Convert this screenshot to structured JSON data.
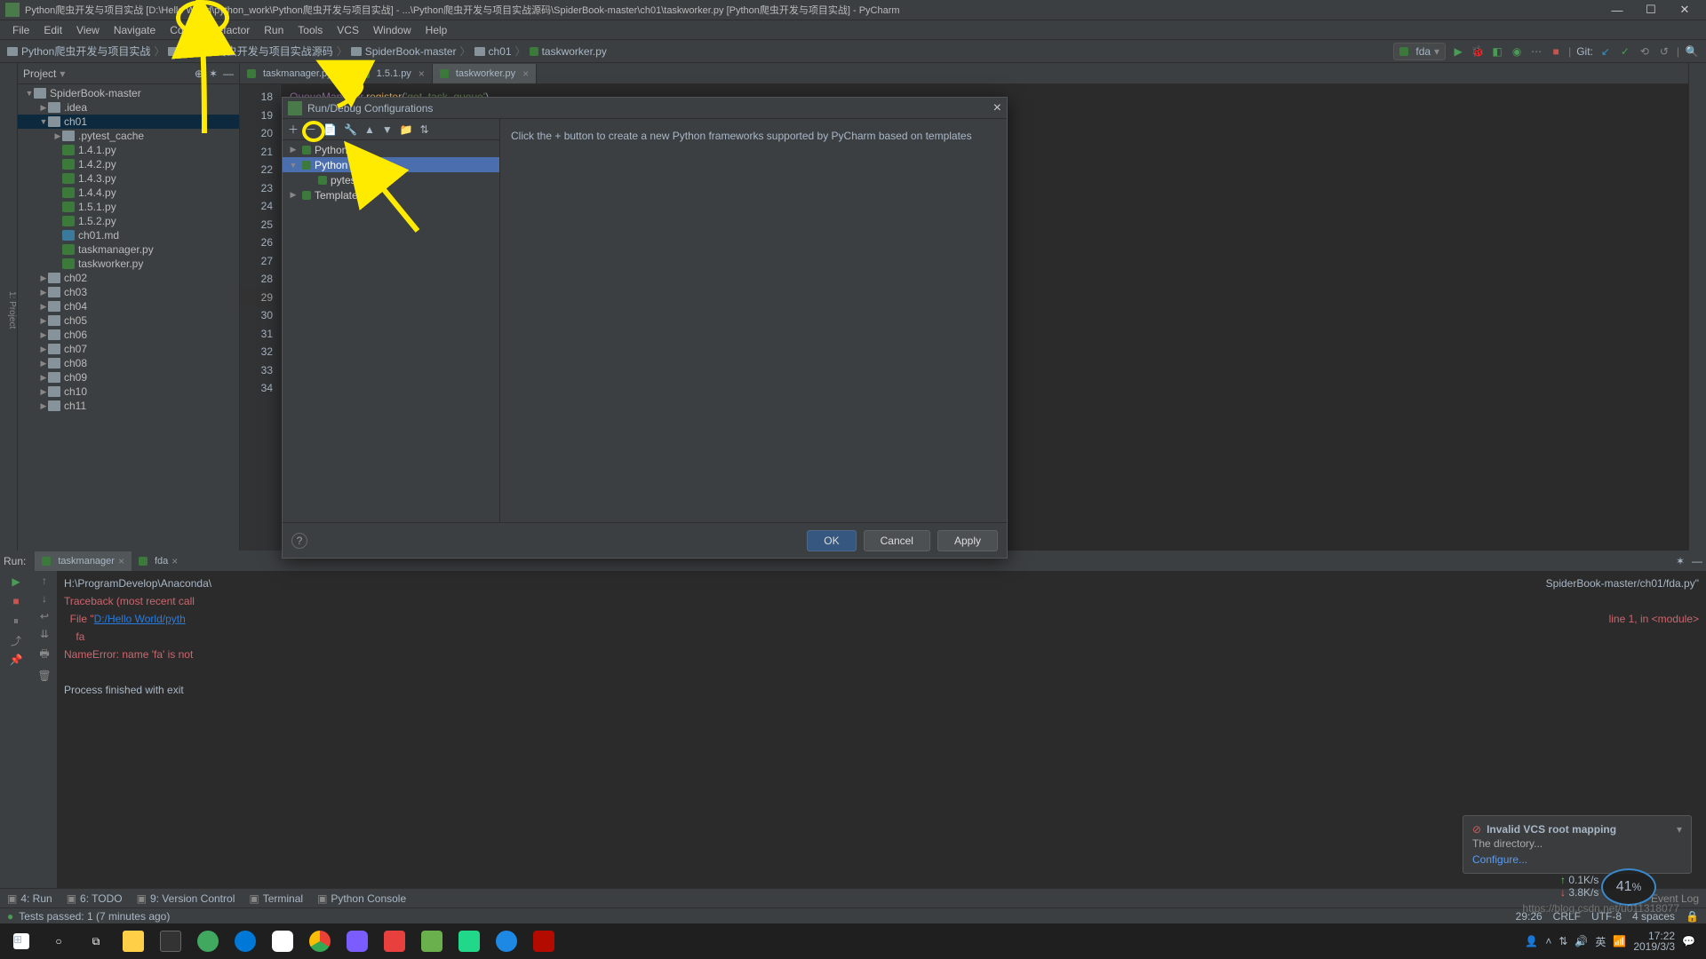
{
  "window": {
    "title": "Python爬虫开发与项目实战 [D:\\Hello World\\python_work\\Python爬虫开发与项目实战] - ...\\Python爬虫开发与项目实战源码\\SpiderBook-master\\ch01\\taskworker.py [Python爬虫开发与项目实战] - PyCharm",
    "min": "—",
    "max": "☐",
    "close": "✕"
  },
  "menu": [
    "File",
    "Edit",
    "View",
    "Navigate",
    "Code",
    "Refactor",
    "Run",
    "Tools",
    "VCS",
    "Window",
    "Help"
  ],
  "crumbs": [
    "Python爬虫开发与项目实战",
    "Python爬虫开发与项目实战源码",
    "SpiderBook-master",
    "ch01",
    "taskworker.py"
  ],
  "runselect": "fda",
  "git_label": "Git:",
  "project": {
    "title": "Project",
    "tree": [
      {
        "d": 0,
        "tw": "▼",
        "ic": "fold",
        "t": "SpiderBook-master"
      },
      {
        "d": 1,
        "tw": "▶",
        "ic": "fold",
        "t": ".idea"
      },
      {
        "d": 1,
        "tw": "▼",
        "ic": "fold",
        "t": "ch01",
        "sel": true
      },
      {
        "d": 2,
        "tw": "▶",
        "ic": "fold",
        "t": ".pytest_cache"
      },
      {
        "d": 2,
        "tw": "",
        "ic": "pyf",
        "t": "1.4.1.py"
      },
      {
        "d": 2,
        "tw": "",
        "ic": "pyf",
        "t": "1.4.2.py"
      },
      {
        "d": 2,
        "tw": "",
        "ic": "pyf",
        "t": "1.4.3.py"
      },
      {
        "d": 2,
        "tw": "",
        "ic": "pyf",
        "t": "1.4.4.py"
      },
      {
        "d": 2,
        "tw": "",
        "ic": "pyf",
        "t": "1.5.1.py"
      },
      {
        "d": 2,
        "tw": "",
        "ic": "pyf",
        "t": "1.5.2.py"
      },
      {
        "d": 2,
        "tw": "",
        "ic": "mdf",
        "t": "ch01.md"
      },
      {
        "d": 2,
        "tw": "",
        "ic": "pyf",
        "t": "taskmanager.py"
      },
      {
        "d": 2,
        "tw": "",
        "ic": "pyf",
        "t": "taskworker.py"
      },
      {
        "d": 1,
        "tw": "▶",
        "ic": "fold",
        "t": "ch02"
      },
      {
        "d": 1,
        "tw": "▶",
        "ic": "fold",
        "t": "ch03"
      },
      {
        "d": 1,
        "tw": "▶",
        "ic": "fold",
        "t": "ch04"
      },
      {
        "d": 1,
        "tw": "▶",
        "ic": "fold",
        "t": "ch05"
      },
      {
        "d": 1,
        "tw": "▶",
        "ic": "fold",
        "t": "ch06"
      },
      {
        "d": 1,
        "tw": "▶",
        "ic": "fold",
        "t": "ch07"
      },
      {
        "d": 1,
        "tw": "▶",
        "ic": "fold",
        "t": "ch08"
      },
      {
        "d": 1,
        "tw": "▶",
        "ic": "fold",
        "t": "ch09"
      },
      {
        "d": 1,
        "tw": "▶",
        "ic": "fold",
        "t": "ch10"
      },
      {
        "d": 1,
        "tw": "▶",
        "ic": "fold",
        "t": "ch11"
      }
    ]
  },
  "editor_tabs": [
    {
      "t": "taskmanager.py"
    },
    {
      "t": "1.5.1.py"
    },
    {
      "t": "taskworker.py",
      "active": true
    }
  ],
  "line_start": 18,
  "line_end": 34,
  "cur_line": 29,
  "code_line18": "QueueManager.register('get_task_queue')",
  "run": {
    "label": "Run:",
    "tabs": [
      {
        "t": "taskmanager",
        "active": true
      },
      {
        "t": "fda"
      }
    ],
    "out1": "H:\\ProgramDevelop\\Anaconda\\",
    "out_right1": "SpiderBook-master/ch01/fda.py\"",
    "out2": "Traceback (most recent call",
    "out3": "  File \"",
    "out3_link": "D:/Hello World/pyth",
    "out_right3": "line 1, in <module>",
    "out4": "    fa",
    "out5": "NameError: name 'fa' is not",
    "out6": "",
    "out7": "Process finished with exit "
  },
  "bottom": [
    "4: Run",
    "6: TODO",
    "9: Version Control",
    "Terminal",
    "Python Console"
  ],
  "status": {
    "left": "Tests passed: 1 (7 minutes ago)",
    "pos": "29:26",
    "le": "CRLF",
    "enc": "UTF-8",
    "ind": "4 spaces"
  },
  "dialog": {
    "title": "Run/Debug Configurations",
    "hint": "Click the + button to create a new Python frameworks supported by PyCharm based on templates",
    "tree": [
      {
        "d": 0,
        "tw": "▶",
        "t": "Python"
      },
      {
        "d": 0,
        "tw": "▼",
        "t": "Python tests",
        "sel": true
      },
      {
        "d": 1,
        "tw": "",
        "t": "pytest for"
      },
      {
        "d": 0,
        "tw": "▶",
        "t": "Templates"
      }
    ],
    "ok": "OK",
    "cancel": "Cancel",
    "apply": "Apply"
  },
  "notif": {
    "title": "Invalid VCS root mapping",
    "body": "The directory...",
    "link": "Configure..."
  },
  "net": {
    "pct": "41",
    "unit": "%",
    "up": "0.1K/s",
    "dn": "3.8K/s"
  },
  "clock": {
    "time": "17:22",
    "date": "2019/3/3"
  },
  "watermark": "https://blog.csdn.net/u011318077"
}
